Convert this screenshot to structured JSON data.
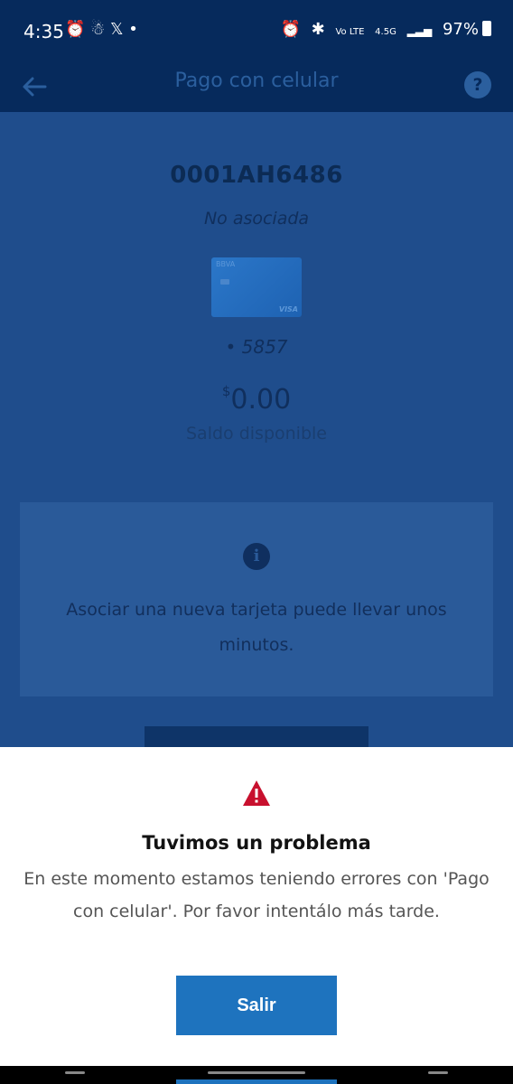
{
  "status_bar": {
    "time": "4:35",
    "left_icons": "⏰ ☃ 𝕏 •",
    "right_icons": [
      "⏰",
      "✱",
      "Vo LTE",
      "4.5G",
      "▂▃▅"
    ],
    "battery": "97%"
  },
  "header": {
    "title": "Pago con celular",
    "back_icon": "arrow-left-icon",
    "help_label": "?"
  },
  "card": {
    "id": "0001AH6486",
    "status": "No asociada",
    "brand": "BBVA",
    "network": "VISA",
    "last4": "• 5857",
    "currency": "$",
    "balance": "0.00",
    "balance_label": "Saldo disponible"
  },
  "info": {
    "icon_label": "i",
    "text": "Asociar una nueva tarjeta puede llevar unos minutos."
  },
  "dialog": {
    "title": "Tuvimos un problema",
    "message": "En este momento estamos teniendo errores con 'Pago con celular'. Por favor intentálo más tarde.",
    "button_label": "Salir"
  },
  "colors": {
    "header_bg": "#062a5c",
    "dimmed_bg": "#1f4d8c",
    "primary_button": "#1e73be",
    "warning_red": "#c8102e"
  }
}
